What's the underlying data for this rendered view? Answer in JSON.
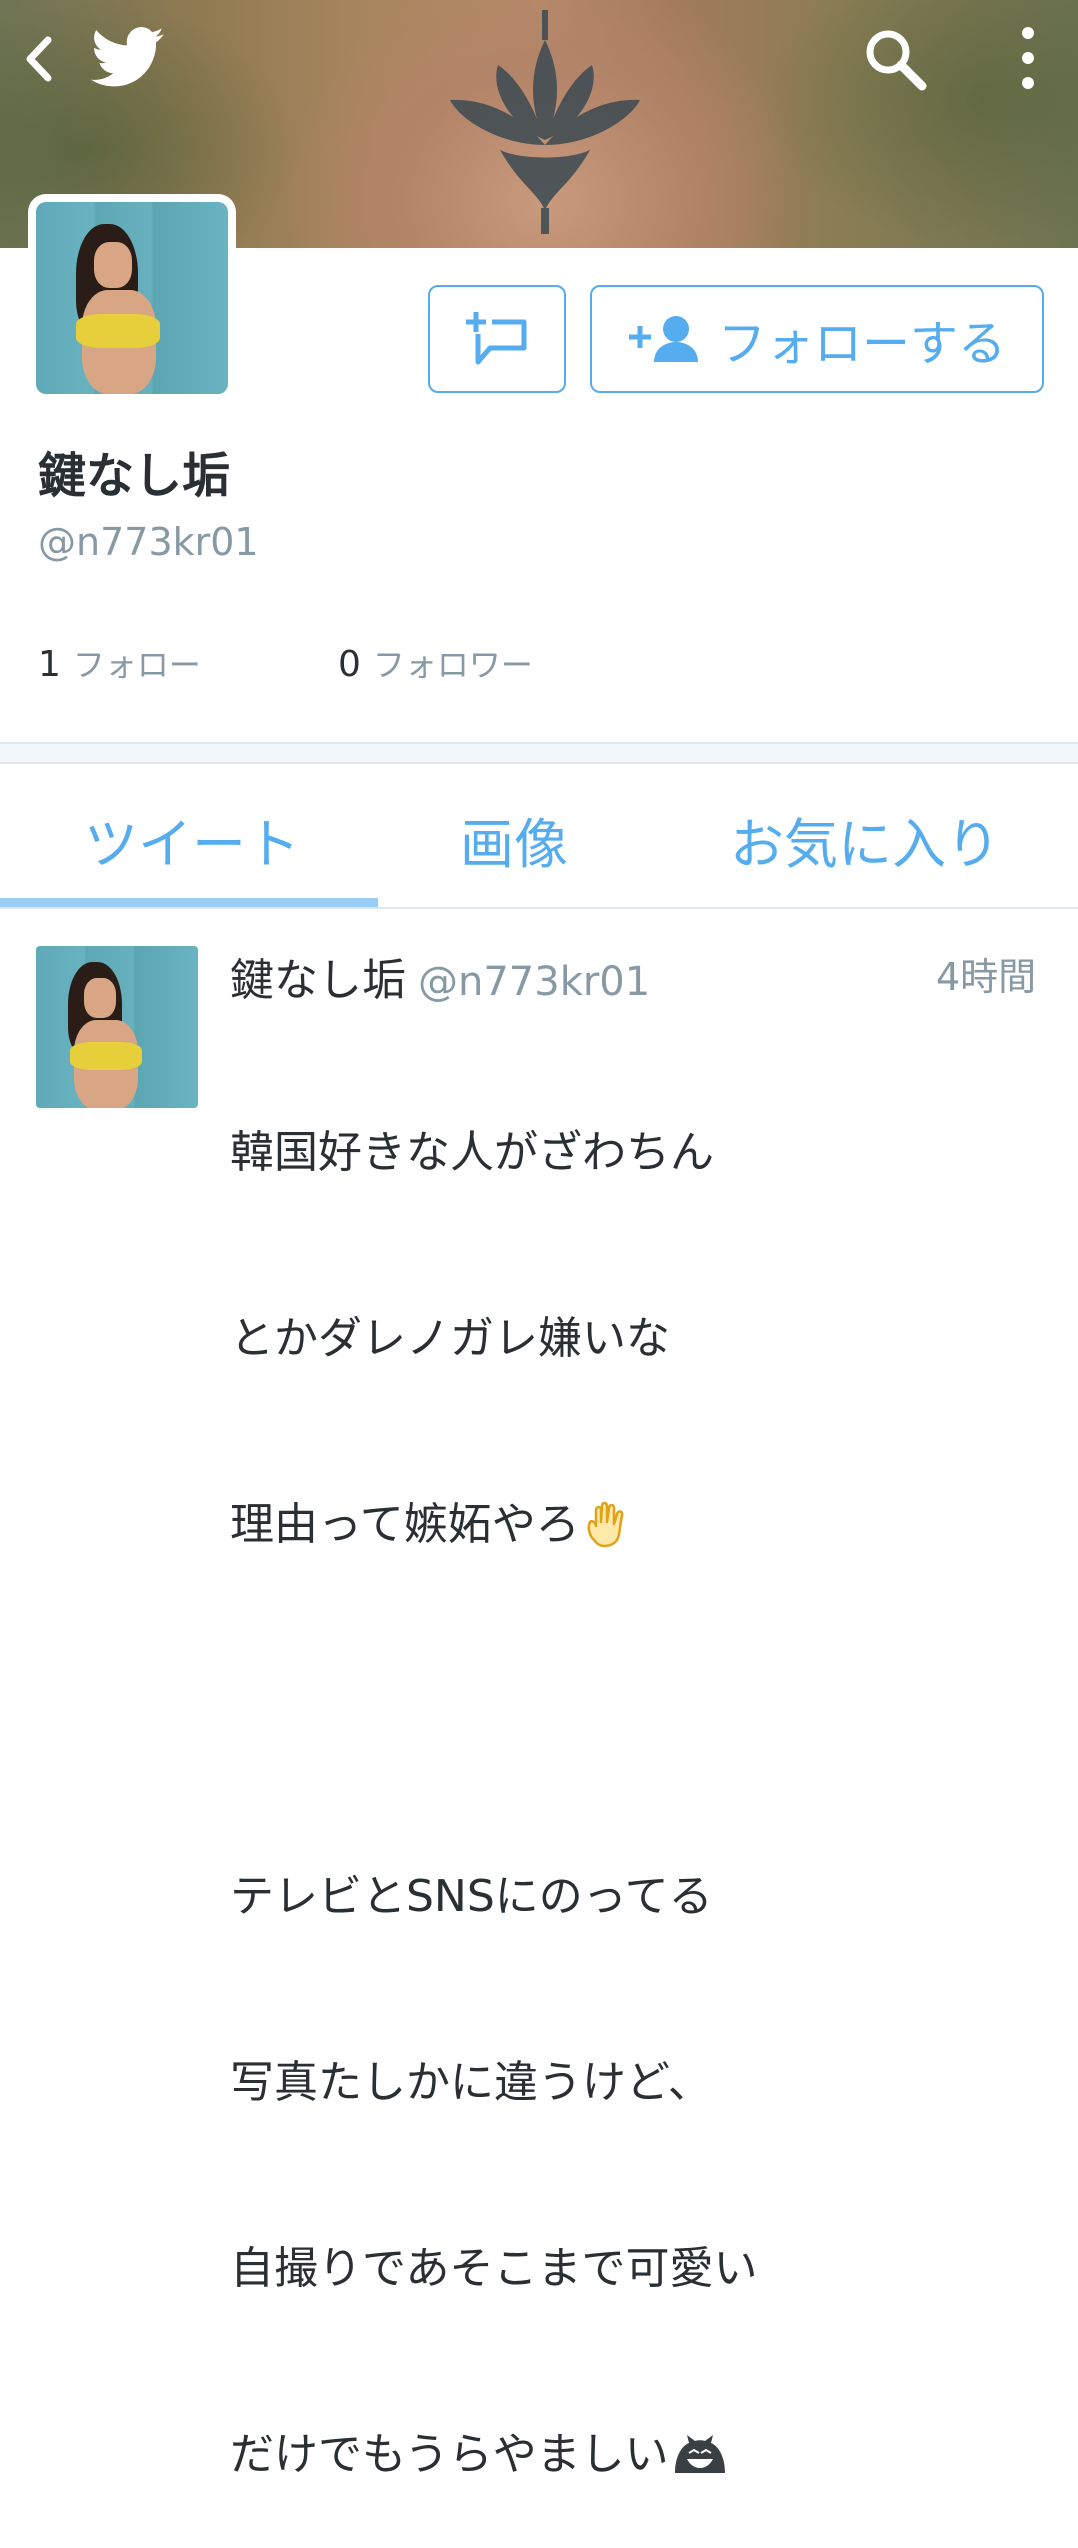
{
  "header": {
    "back_icon": "chevron-left-icon",
    "logo_icon": "twitter-bird-icon",
    "search_icon": "search-icon",
    "menu_icon": "more-vert-icon"
  },
  "profile": {
    "name": "鍵なし垢",
    "handle": "@n773kr01",
    "follow_button_label": "フォローする",
    "following_count": "1",
    "following_label": "フォロー",
    "followers_count": "0",
    "followers_label": "フォロワー"
  },
  "tabs": [
    {
      "label": "ツイート",
      "active": true
    },
    {
      "label": "画像",
      "active": false
    },
    {
      "label": "お気に入り",
      "active": false
    }
  ],
  "tweet": {
    "name": "鍵なし垢",
    "handle": "@n773kr01",
    "time": "4時間",
    "body_lines": [
      "韓国好きな人がざわちん",
      "とかダレノガレ嫌いな",
      "理由って嫉妬やろ",
      "",
      "テレビとSNSにのってる",
      "写真たしかに違うけど、",
      "自撮りであそこまで可愛い",
      "だけでもうらやましい"
    ],
    "emoji": [
      "raised-hand-emoji",
      "grinning-cat-emoji"
    ]
  },
  "colors": {
    "accent": "#55acee",
    "muted": "#8899a6",
    "text": "#292f33"
  }
}
